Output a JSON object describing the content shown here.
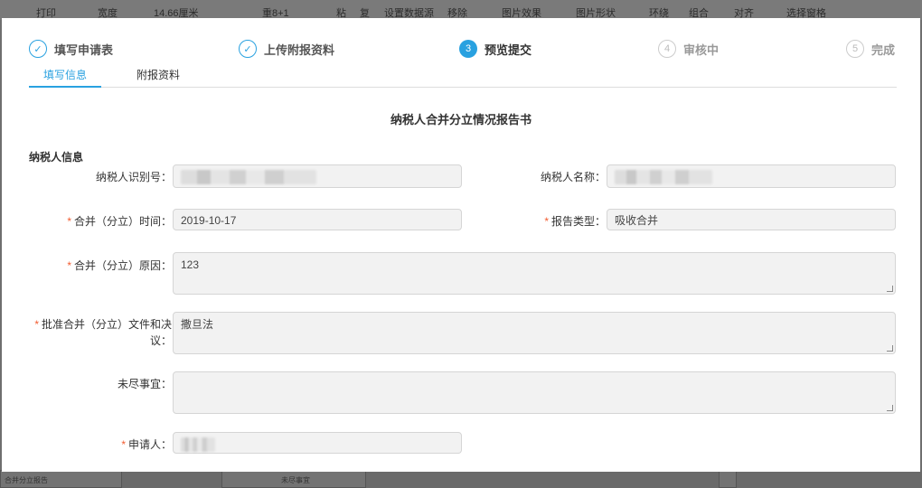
{
  "background": {
    "toolbar_items": [
      "打印",
      "宽度",
      "14.66厘米",
      "重8+1",
      "粘",
      "复",
      "设置数据源",
      "移除",
      "图片效果",
      "图片形状",
      "环绕",
      "组合",
      "对齐",
      "选择窗格"
    ],
    "bottom_left": "合并分立报告",
    "bottom_mid": "未尽事宜"
  },
  "steps": [
    {
      "num": "✓",
      "label": "填写申请表",
      "state": "done"
    },
    {
      "num": "✓",
      "label": "上传附报资料",
      "state": "done"
    },
    {
      "num": "3",
      "label": "预览提交",
      "state": "active"
    },
    {
      "num": "4",
      "label": "审核中",
      "state": "todo"
    },
    {
      "num": "5",
      "label": "完成",
      "state": "todo"
    }
  ],
  "tabs": {
    "info": "填写信息",
    "attachments": "附报资料"
  },
  "form_title": "纳税人合并分立情况报告书",
  "section_title": "纳税人信息",
  "fields": {
    "taxpayer_id": {
      "label": "纳税人识别号：",
      "value": ""
    },
    "taxpayer_name": {
      "label": "纳税人名称：",
      "value": ""
    },
    "merge_time": {
      "label": "合并（分立）时间：",
      "value": "2019-10-17"
    },
    "report_type": {
      "label": "报告类型：",
      "value": "吸收合并"
    },
    "merge_reason": {
      "label": "合并（分立）原因：",
      "value": "123"
    },
    "approval_docs": {
      "label_line1": "批准合并（分立）文件和决",
      "label_line2": "议：",
      "value": "撒旦法"
    },
    "other_matters": {
      "label": "未尽事宜：",
      "value": ""
    },
    "applicant": {
      "label": "申请人：",
      "value": ""
    }
  },
  "required_mark": "*",
  "colors": {
    "accent": "#29a1e0",
    "required": "#f25c30",
    "field_bg": "#f2f2f2"
  }
}
